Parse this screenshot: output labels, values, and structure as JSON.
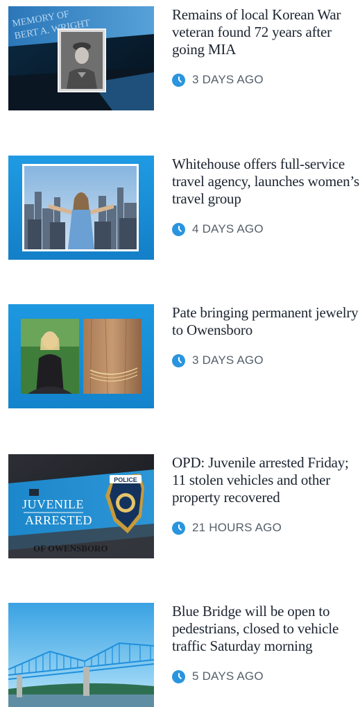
{
  "feed": {
    "articles": [
      {
        "headline": "Remains of local Korean War veteran found 72 years after going MIA",
        "timestamp": "3 DAYS AGO",
        "image": {
          "subject": "vintage-portrait-of-soldier-on-memorial-banner",
          "banner_text": "MEMORY OF BERT A. WRIGHT"
        }
      },
      {
        "headline": "Whitehouse offers full-service travel agency, launches women’s travel group",
        "timestamp": "4 DAYS AGO",
        "image": {
          "subject": "woman-with-arms-outstretched-above-city-skyline"
        }
      },
      {
        "headline": "Pate bringing permanent jewelry to Owensboro",
        "timestamp": "3 DAYS AGO",
        "image": {
          "subject": "woman-portrait-and-bracelet-closeup"
        }
      },
      {
        "headline": "OPD: Juvenile arrested Friday; 11 stolen vehicles and other property recovered",
        "timestamp": "21 HOURS AGO",
        "image": {
          "subject": "juvenile-arrested-graphic-with-police-badge",
          "overlay_title": "JUVENILE\nARRESTED",
          "badge_text": "POLICE",
          "footer_text": "OF OWENSBORO"
        }
      },
      {
        "headline": "Blue Bridge will be open to pedestrians, closed to vehicle traffic Saturday morning",
        "timestamp": "5 DAYS AGO",
        "image": {
          "subject": "blue-truss-bridge-over-river"
        }
      }
    ]
  },
  "colors": {
    "accent": "#2a95de",
    "headline_text": "#1c2430",
    "timestamp_text": "#55606b",
    "thumbnail_blue": "#1a8fd6"
  },
  "icons": {
    "timestamp": "clock-icon"
  }
}
